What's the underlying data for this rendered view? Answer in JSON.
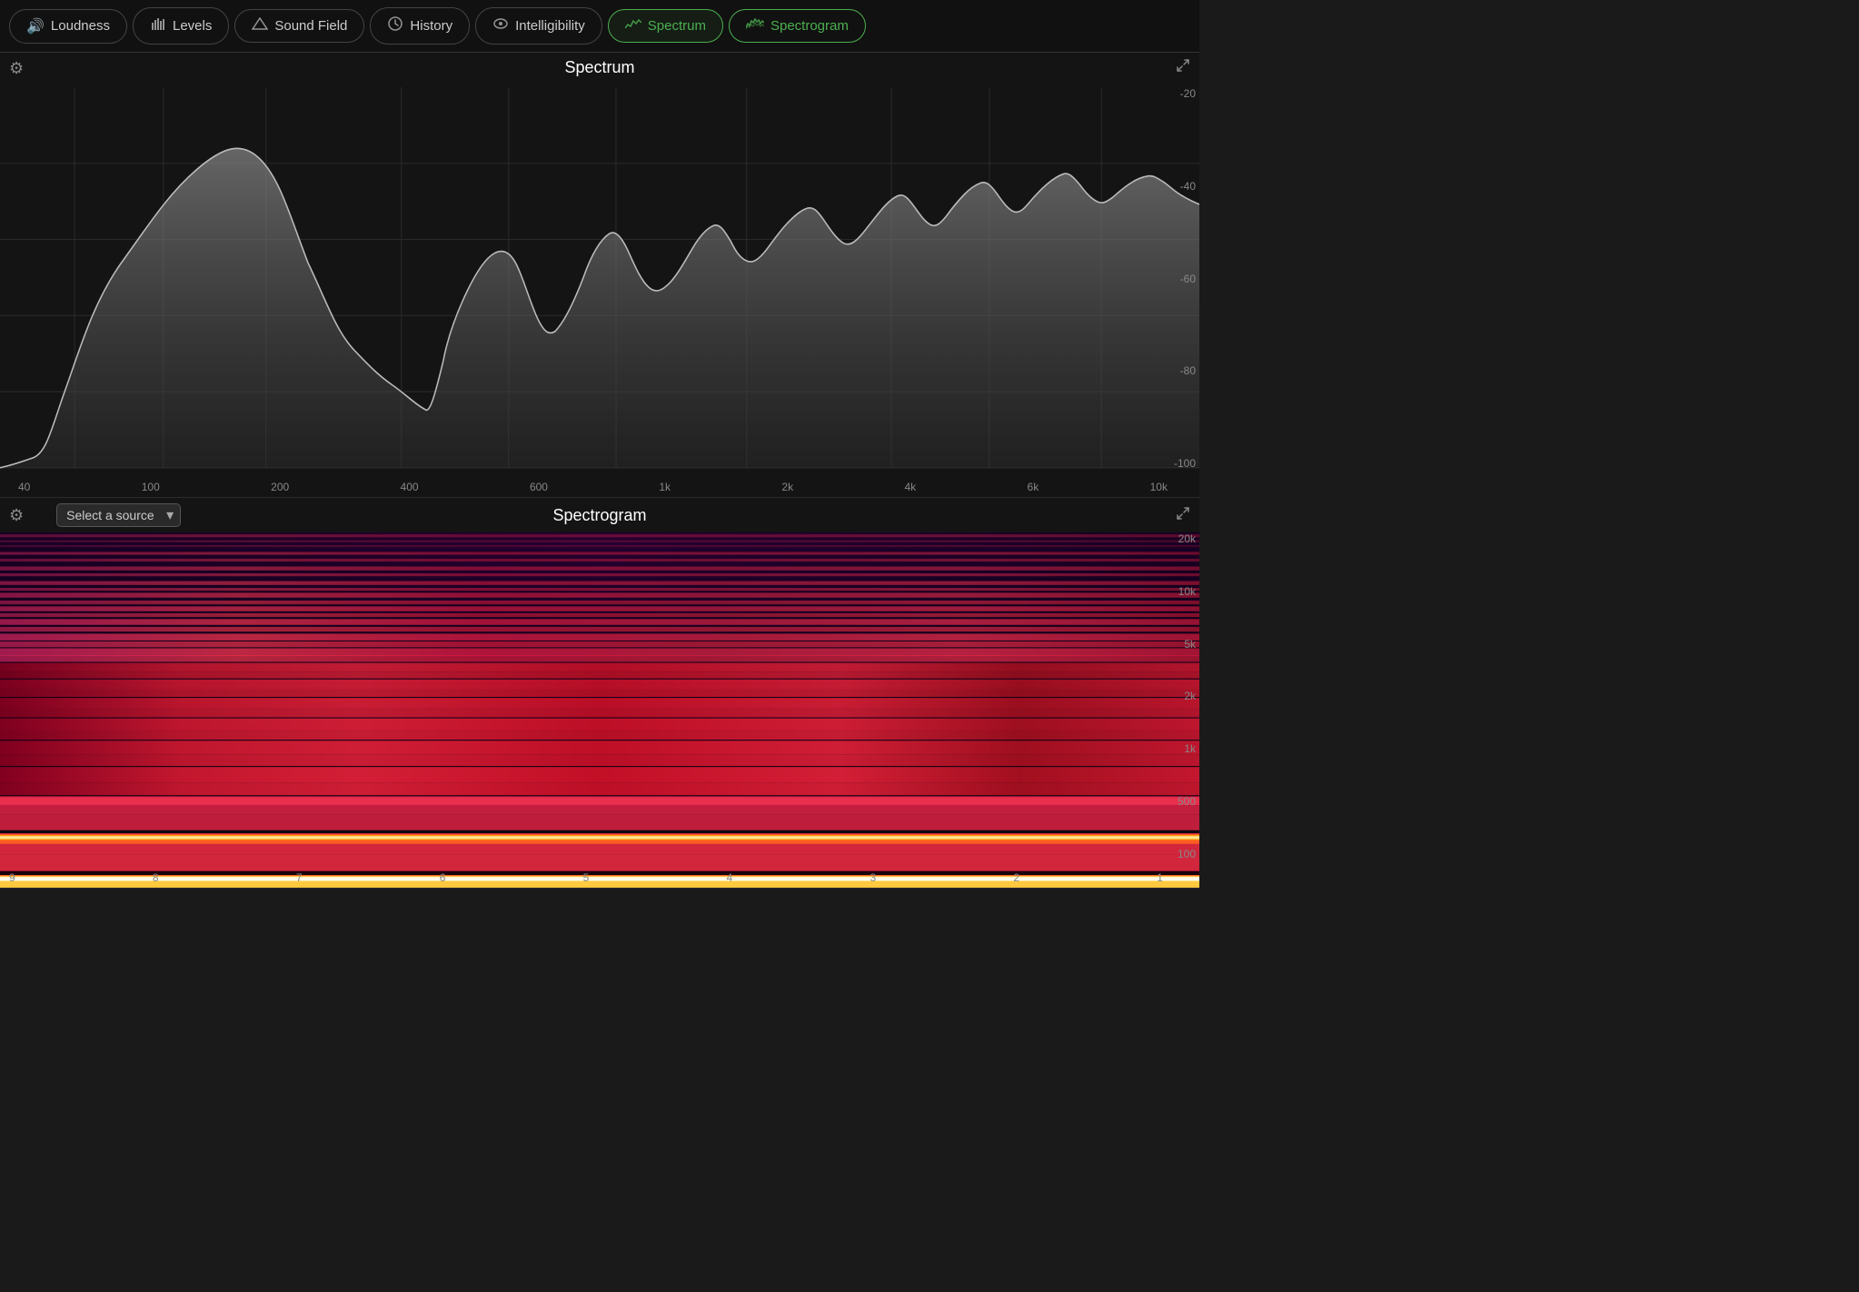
{
  "nav": {
    "tabs": [
      {
        "id": "loudness",
        "label": "Loudness",
        "icon": "🔊",
        "active": false
      },
      {
        "id": "levels",
        "label": "Levels",
        "icon": "📊",
        "active": false
      },
      {
        "id": "sound-field",
        "label": "Sound Field",
        "icon": "△",
        "active": false
      },
      {
        "id": "history",
        "label": "History",
        "icon": "🎧",
        "active": false
      },
      {
        "id": "intelligibility",
        "label": "Intelligibility",
        "icon": "👂",
        "active": false
      },
      {
        "id": "spectrum",
        "label": "Spectrum",
        "icon": "📈",
        "active": true
      },
      {
        "id": "spectrogram",
        "label": "Spectrogram",
        "icon": "📉",
        "active": true
      }
    ]
  },
  "spectrum": {
    "title": "Spectrum",
    "x_labels": [
      "40",
      "100",
      "200",
      "400",
      "600",
      "1k",
      "2k",
      "4k",
      "6k",
      "10k"
    ],
    "y_labels": [
      "-20",
      "-40",
      "-60",
      "-80",
      "-100"
    ]
  },
  "spectrogram": {
    "title": "Spectrogram",
    "source_placeholder": "Select a source",
    "x_labels": [
      "9",
      "8",
      "7",
      "6",
      "5",
      "4",
      "3",
      "2",
      "1"
    ],
    "y_labels": [
      "20k",
      "10k",
      "5k",
      "2k",
      "1k",
      "500",
      "100"
    ]
  }
}
